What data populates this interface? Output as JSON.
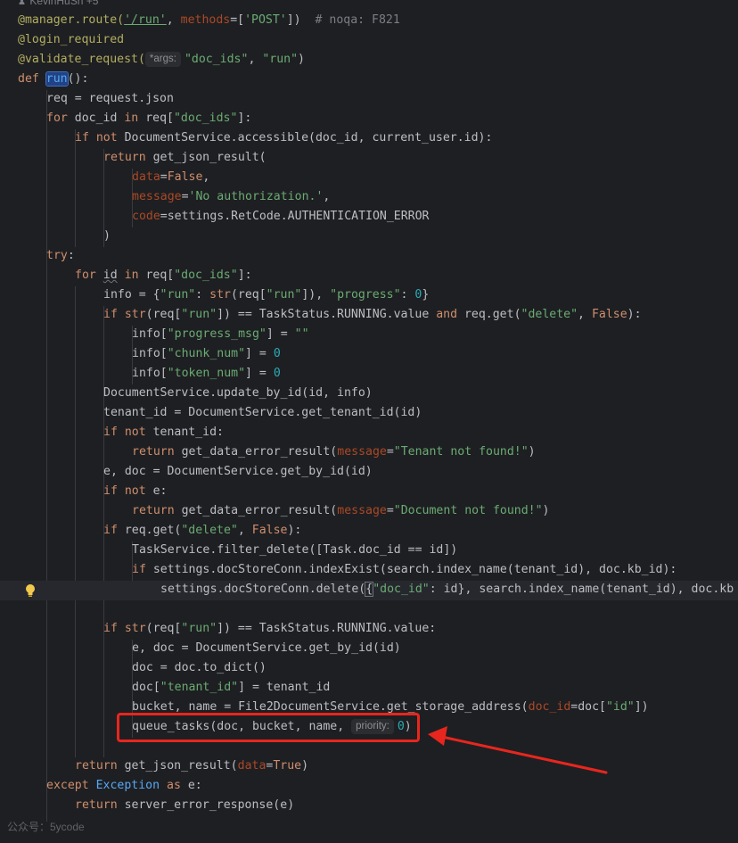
{
  "author": {
    "icon": "person-icon",
    "text": "KevinHuSh +5"
  },
  "lines": {
    "l1": {
      "a": "@manager.route(",
      "b": "'/run'",
      "c": ", ",
      "d": "methods",
      "e": "=[",
      "f": "'POST'",
      "g": "])",
      "h": "# noqa: F821"
    },
    "l2": {
      "a": "@login_required"
    },
    "l3": {
      "a": "@validate_request(",
      "hint": "*args:",
      "b": "\"doc_ids\"",
      "c": ", ",
      "d": "\"run\"",
      "e": ")"
    },
    "l4": {
      "a": "def ",
      "b": "run",
      "c": "():"
    },
    "l5": {
      "a": "req = request.json"
    },
    "l6": {
      "a": "for",
      "b": " doc_id ",
      "c": "in",
      "d": " req[",
      "e": "\"doc_ids\"",
      "f": "]:"
    },
    "l7": {
      "a": "if not",
      "b": " DocumentService.accessible(doc_id, current_user.id):"
    },
    "l8": {
      "a": "return",
      "b": " get_json_result("
    },
    "l9": {
      "a": "data",
      "b": "=",
      "c": "False",
      "d": ","
    },
    "l10": {
      "a": "message",
      "b": "=",
      "c": "'No authorization.'",
      "d": ","
    },
    "l11": {
      "a": "code",
      "b": "=settings.RetCode.AUTHENTICATION_ERROR"
    },
    "l12": {
      "a": ")"
    },
    "l13": {
      "a": "try",
      "b": ":"
    },
    "l14": {
      "a": "for",
      "b": " ",
      "c": "id",
      "d": " ",
      "e": "in",
      "f": " req[",
      "g": "\"doc_ids\"",
      "h": "]:"
    },
    "l15": {
      "a": "info = {",
      "b": "\"run\"",
      "c": ": ",
      "d": "str",
      "e": "(req[",
      "f": "\"run\"",
      "g": "]), ",
      "h": "\"progress\"",
      "i": ": ",
      "j": "0",
      "k": "}"
    },
    "l16": {
      "a": "if",
      "b": " ",
      "c": "str",
      "d": "(req[",
      "e": "\"run\"",
      "f": "]) == TaskStatus.RUNNING.value ",
      "g": "and",
      "h": " req.get(",
      "i": "\"delete\"",
      "j": ", ",
      "k": "False",
      "l": "):"
    },
    "l17": {
      "a": "info[",
      "b": "\"progress_msg\"",
      "c": "] = ",
      "d": "\"\""
    },
    "l18": {
      "a": "info[",
      "b": "\"chunk_num\"",
      "c": "] = ",
      "d": "0"
    },
    "l19": {
      "a": "info[",
      "b": "\"token_num\"",
      "c": "] = ",
      "d": "0"
    },
    "l20": {
      "a": "DocumentService.update_by_id(id, info)"
    },
    "l21": {
      "a": "tenant_id = DocumentService.get_tenant_id(id)"
    },
    "l22": {
      "a": "if not",
      "b": " tenant_id:"
    },
    "l23": {
      "a": "return",
      "b": " get_data_error_result(",
      "c": "message",
      "d": "=",
      "e": "\"Tenant not found!\"",
      "f": ")"
    },
    "l24": {
      "a": "e, doc = DocumentService.get_by_id(id)"
    },
    "l25": {
      "a": "if not",
      "b": " e:"
    },
    "l26": {
      "a": "return",
      "b": " get_data_error_result(",
      "c": "message",
      "d": "=",
      "e": "\"Document not found!\"",
      "f": ")"
    },
    "l27": {
      "a": "if",
      "b": " req.get(",
      "c": "\"delete\"",
      "d": ", ",
      "e": "False",
      "f": "):"
    },
    "l28": {
      "a": "TaskService.filter_delete([Task.doc_id == id])"
    },
    "l29": {
      "a": "if",
      "b": " settings.docStoreConn.indexExist(search.index_name(tenant_id), doc.kb_id):"
    },
    "l30": {
      "a": "settings.docStoreConn.delete(",
      "b": "{",
      "c": "\"doc_id\"",
      "d": ": id",
      "e": "}",
      "f": ", search.index_name(tenant_id), doc.kb"
    },
    "l31": {
      "a": "if",
      "b": " ",
      "c": "str",
      "d": "(req[",
      "e": "\"run\"",
      "f": "]) == TaskStatus.RUNNING.value:"
    },
    "l32": {
      "a": "e, doc = DocumentService.get_by_id(id)"
    },
    "l33": {
      "a": "doc = doc.to_dict()"
    },
    "l34": {
      "a": "doc[",
      "b": "\"tenant_id\"",
      "c": "] = tenant_id"
    },
    "l35": {
      "a": "bucket, name = File2DocumentService.get_storage_address(",
      "b": "doc_id",
      "c": "=doc[",
      "d": "\"id\"",
      "e": "])"
    },
    "l36": {
      "a": "queue_tasks(doc, bucket, name, ",
      "hint": "priority:",
      "b": "0",
      "c": ")"
    },
    "l37": {
      "a": "return",
      "b": " get_json_result(",
      "c": "data",
      "d": "=",
      "e": "True",
      "f": ")"
    },
    "l38": {
      "a": "except",
      "b": " ",
      "c": "Exception",
      "d": " ",
      "e": "as",
      "f": " e:"
    },
    "l39": {
      "a": "return",
      "b": " server_error_response(e)"
    }
  },
  "icons": {
    "intention": "lightbulb-icon",
    "annotation": "red-arrow-annotation"
  },
  "colors": {
    "background": "#1e1f22",
    "keyword": "#cf8e6d",
    "string": "#6aab73",
    "number": "#2aacb8",
    "decorator": "#b3ae60",
    "param": "#aa4926",
    "annotation": "#e8261e"
  },
  "watermark": "公众号：5ycode"
}
